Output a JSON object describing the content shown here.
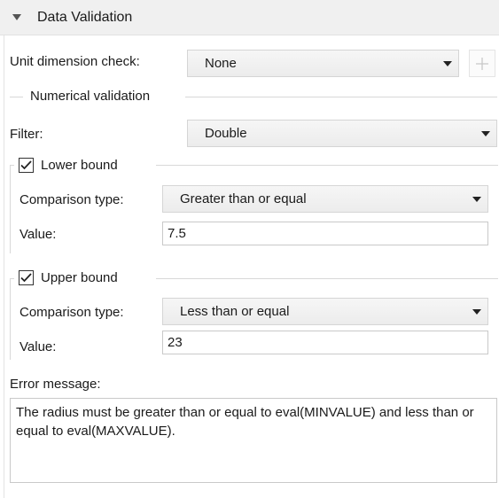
{
  "header": {
    "title": "Data Validation",
    "icon": "triangle-down-icon"
  },
  "unit_dimension": {
    "label": "Unit dimension check:",
    "value": "None",
    "add_icon": "plus-icon"
  },
  "numerical": {
    "section_title": "Numerical validation",
    "filter_label": "Filter:",
    "filter_value": "Double"
  },
  "lower_bound": {
    "checkbox_label": "Lower bound",
    "checked": true,
    "comparison_label": "Comparison type:",
    "comparison_value": "Greater than or equal",
    "value_label": "Value:",
    "value": "7.5"
  },
  "upper_bound": {
    "checkbox_label": "Upper bound",
    "checked": true,
    "comparison_label": "Comparison type:",
    "comparison_value": "Less than or equal",
    "value_label": "Value:",
    "value": "23"
  },
  "error": {
    "label": "Error message:",
    "text": "The radius must be greater than or equal to eval(MINVALUE) and less than or equal to eval(MAXVALUE)."
  },
  "colors": {
    "header_bg": "#f0f0f0",
    "border": "#d8d8d8",
    "combo_bg": "#f0f0f0"
  }
}
